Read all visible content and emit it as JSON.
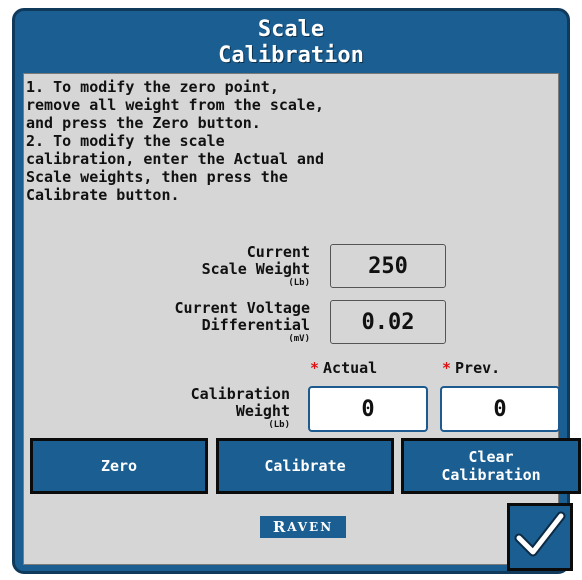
{
  "dialog": {
    "title_line1": "Scale",
    "title_line2": "Calibration"
  },
  "instructions": "1. To modify the zero point,\nremove all weight from the scale,\nand press the Zero button.\n2. To modify the scale\ncalibration, enter the Actual and\nScale weights, then press the\nCalibrate button.",
  "current_scale_weight": {
    "label_line1": "Current",
    "label_line2": "Scale Weight",
    "unit": "(Lb)",
    "value": "250"
  },
  "current_voltage": {
    "label_line1": "Current Voltage",
    "label_line2": "Differential",
    "unit": "(mV)",
    "value": "0.02"
  },
  "calibration_weight": {
    "label_line1": "Calibration",
    "label_line2": "Weight",
    "unit": "(Lb)",
    "actual_header": "Actual",
    "prev_header": "Prev.",
    "required_marker": "*",
    "actual_value": "0",
    "prev_value": "0"
  },
  "buttons": {
    "zero": "Zero",
    "calibrate": "Calibrate",
    "clear_line1": "Clear",
    "clear_line2": "Calibration"
  },
  "logo": {
    "text_first": "R",
    "text_rest": "AVEN"
  },
  "colors": {
    "accent": "#1a5e92",
    "panel": "#d6d6d6",
    "required": "#dd1111"
  },
  "icons": {
    "confirm": "checkmark-icon"
  }
}
